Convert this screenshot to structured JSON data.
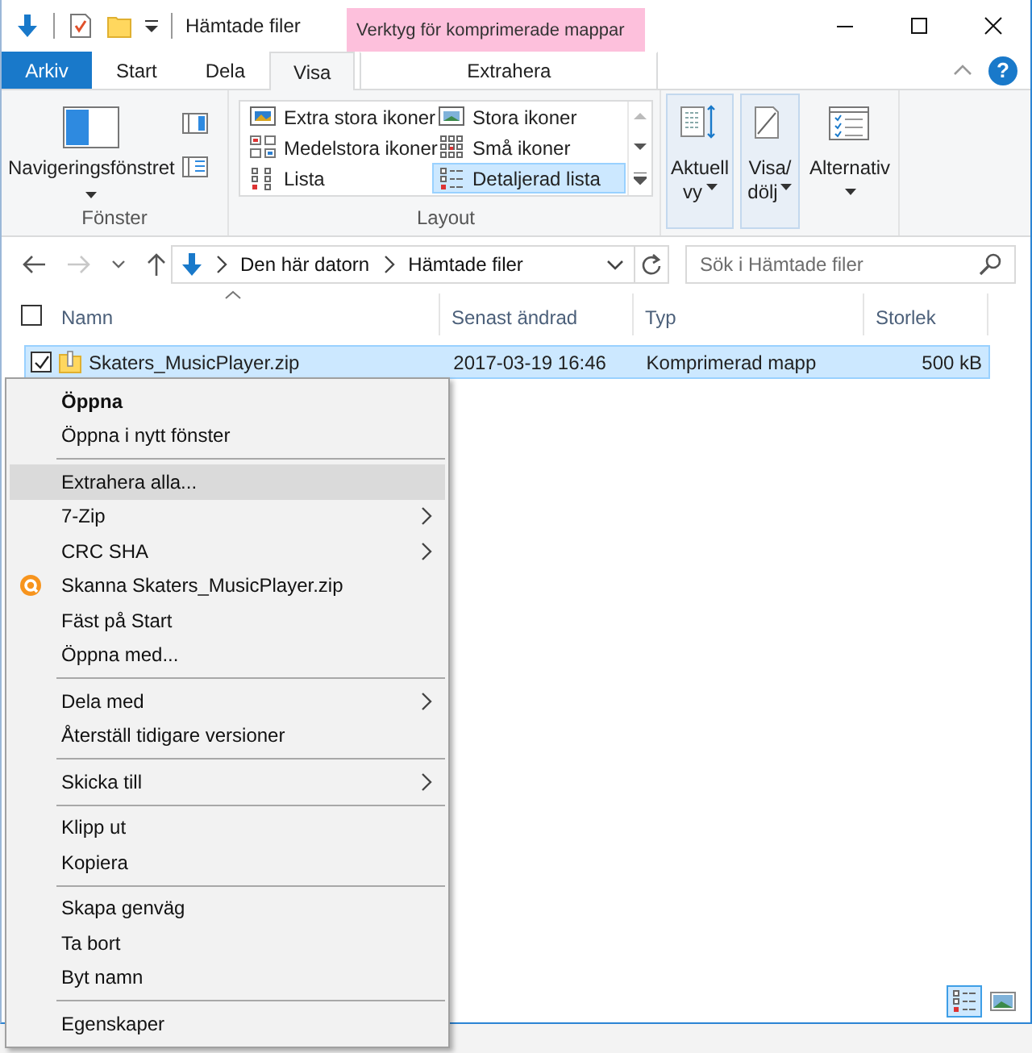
{
  "window": {
    "title": "Hämtade filer"
  },
  "contextual_tab_group": {
    "label": "Verktyg för komprimerade mappar"
  },
  "tabs": [
    {
      "label": "Arkiv",
      "kind": "file",
      "selected": false
    },
    {
      "label": "Start",
      "kind": "normal",
      "selected": false
    },
    {
      "label": "Dela",
      "kind": "normal",
      "selected": false
    },
    {
      "label": "Visa",
      "kind": "normal",
      "selected": true
    },
    {
      "label": "Extrahera",
      "kind": "contextual",
      "selected": false
    }
  ],
  "help_button": {
    "label": "?"
  },
  "ribbon": {
    "groups": [
      {
        "kind": "panes",
        "label": "Fönster",
        "button": "Navigeringsfönstret"
      },
      {
        "kind": "layout",
        "label": "Layout",
        "options": [
          {
            "kind": "xl",
            "label": "Extra stora ikoner",
            "selected": false
          },
          {
            "kind": "large",
            "label": "Stora ikoner",
            "selected": false
          },
          {
            "kind": "medium",
            "label": "Medelstora ikoner",
            "selected": false
          },
          {
            "kind": "small",
            "label": "Små ikoner",
            "selected": false
          },
          {
            "kind": "list",
            "label": "Lista",
            "selected": false
          },
          {
            "kind": "details",
            "label": "Detaljerad lista",
            "selected": true
          }
        ]
      },
      {
        "kind": "view",
        "buttons": [
          {
            "kind": "current",
            "lines": [
              "Aktuell",
              "vy"
            ],
            "highlighted": true
          },
          {
            "kind": "showhide",
            "lines": [
              "Visa/",
              "dölj"
            ],
            "highlighted": true
          },
          {
            "kind": "options",
            "lines": [
              "Alternativ"
            ],
            "highlighted": false
          }
        ]
      }
    ]
  },
  "address": {
    "breadcrumbs": [
      "Den här datorn",
      "Hämtade filer"
    ]
  },
  "search": {
    "placeholder": "Sök i Hämtade filer"
  },
  "file_list": {
    "select_all_checked": false,
    "columns": [
      {
        "label": "Namn",
        "sorted": true
      },
      {
        "label": "Senast ändrad",
        "sorted": false
      },
      {
        "label": "Typ",
        "sorted": false
      },
      {
        "label": "Storlek",
        "sorted": false
      }
    ],
    "rows": [
      {
        "name": "Skaters_MusicPlayer.zip",
        "modified": "2017-03-19 16:46",
        "type": "Komprimerad mapp",
        "size": "500 kB",
        "selected": true,
        "checked": true
      }
    ]
  },
  "context_menu": [
    {
      "kind": "item",
      "label": "Öppna",
      "bold": true,
      "submenu": false,
      "selected": false
    },
    {
      "kind": "item",
      "label": "Öppna i nytt fönster",
      "bold": false,
      "submenu": false,
      "selected": false
    },
    {
      "kind": "separator"
    },
    {
      "kind": "item",
      "label": "Extrahera alla...",
      "bold": false,
      "submenu": false,
      "selected": true
    },
    {
      "kind": "item",
      "label": "7-Zip",
      "bold": false,
      "submenu": true,
      "selected": false
    },
    {
      "kind": "item",
      "label": "CRC SHA",
      "bold": false,
      "submenu": true,
      "selected": false
    },
    {
      "kind": "app",
      "label": "Skanna Skaters_MusicPlayer.zip",
      "bold": false,
      "submenu": false,
      "selected": false
    },
    {
      "kind": "item",
      "label": "Fäst på Start",
      "bold": false,
      "submenu": false,
      "selected": false
    },
    {
      "kind": "item",
      "label": "Öppna med...",
      "bold": false,
      "submenu": false,
      "selected": false
    },
    {
      "kind": "separator"
    },
    {
      "kind": "item",
      "label": "Dela med",
      "bold": false,
      "submenu": true,
      "selected": false
    },
    {
      "kind": "item",
      "label": "Återställ tidigare versioner",
      "bold": false,
      "submenu": false,
      "selected": false
    },
    {
      "kind": "separator"
    },
    {
      "kind": "item",
      "label": "Skicka till",
      "bold": false,
      "submenu": true,
      "selected": false
    },
    {
      "kind": "separator"
    },
    {
      "kind": "item",
      "label": "Klipp ut",
      "bold": false,
      "submenu": false,
      "selected": false
    },
    {
      "kind": "item",
      "label": "Kopiera",
      "bold": false,
      "submenu": false,
      "selected": false
    },
    {
      "kind": "separator"
    },
    {
      "kind": "item",
      "label": "Skapa genväg",
      "bold": false,
      "submenu": false,
      "selected": false
    },
    {
      "kind": "item",
      "label": "Ta bort",
      "bold": false,
      "submenu": false,
      "selected": false
    },
    {
      "kind": "item",
      "label": "Byt namn",
      "bold": false,
      "submenu": false,
      "selected": false
    },
    {
      "kind": "separator"
    },
    {
      "kind": "item",
      "label": "Egenskaper",
      "bold": false,
      "submenu": false,
      "selected": false
    }
  ],
  "view_buttons": [
    {
      "kind": "details",
      "selected": true
    },
    {
      "kind": "tiles",
      "selected": false
    }
  ]
}
